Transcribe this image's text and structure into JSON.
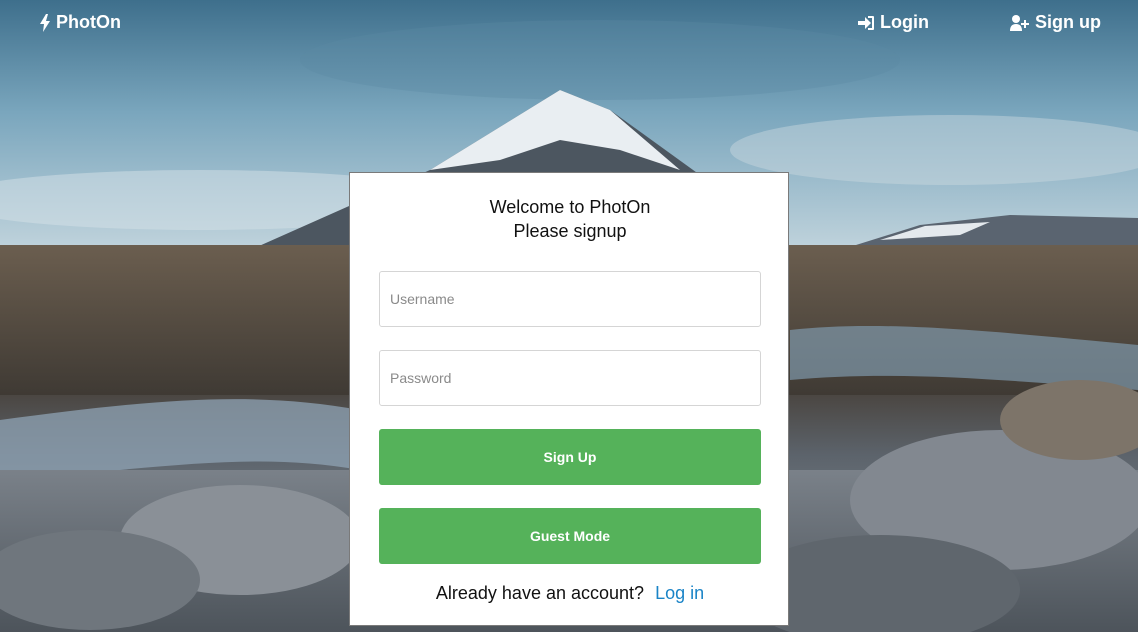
{
  "navbar": {
    "brand": "PhotOn",
    "brand_icon": "bolt-icon",
    "login_label": "Login",
    "login_icon": "sign-in-icon",
    "signup_label": "Sign up",
    "signup_icon": "user-plus-icon"
  },
  "form": {
    "title_line1": "Welcome to PhotOn",
    "title_line2": "Please signup",
    "username_placeholder": "Username",
    "password_placeholder": "Password",
    "signup_button": "Sign Up",
    "guest_button": "Guest Mode",
    "footer_text": "Already have an account?",
    "footer_link": "Log in"
  },
  "colors": {
    "button_green": "#55b25a",
    "link_blue": "#1a84c7"
  }
}
